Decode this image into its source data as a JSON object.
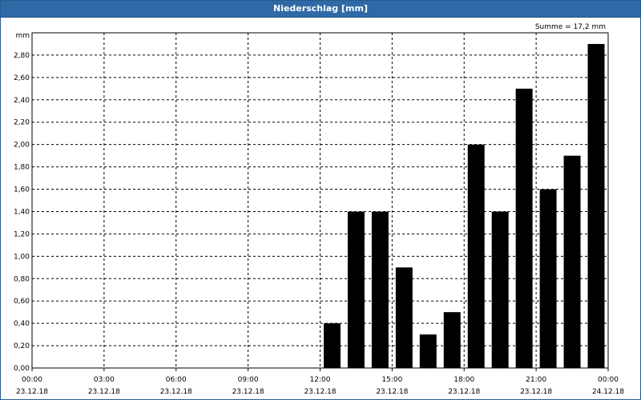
{
  "window": {
    "title": "Niederschlag [mm]"
  },
  "chart_data": {
    "type": "bar",
    "title": "Niederschlag [mm]",
    "ylabel": "mm",
    "annotation": "Summe = 17,2 mm",
    "ylim": [
      0,
      3.0
    ],
    "yticks": [
      "0,00",
      "0,20",
      "0,40",
      "0,60",
      "0,80",
      "1,00",
      "1,20",
      "1,40",
      "1,60",
      "1,80",
      "2,00",
      "2,20",
      "2,40",
      "2,60",
      "2,80"
    ],
    "xticks": [
      {
        "time": "00:00",
        "date": "23.12.18"
      },
      {
        "time": "03:00",
        "date": "23.12.18"
      },
      {
        "time": "06:00",
        "date": "23.12.18"
      },
      {
        "time": "09:00",
        "date": "23.12.18"
      },
      {
        "time": "12:00",
        "date": "23.12.18"
      },
      {
        "time": "15:00",
        "date": "23.12.18"
      },
      {
        "time": "18:00",
        "date": "23.12.18"
      },
      {
        "time": "21:00",
        "date": "23.12.18"
      },
      {
        "time": "00:00",
        "date": "24.12.18"
      }
    ],
    "grid": true,
    "bar_color": "#000000",
    "series": [
      {
        "x": [
          "00:00",
          "01:00",
          "02:00",
          "03:00",
          "04:00",
          "05:00",
          "06:00",
          "07:00",
          "08:00",
          "09:00",
          "10:00",
          "11:00",
          "12:00",
          "13:00",
          "14:00",
          "15:00",
          "16:00",
          "17:00",
          "18:00",
          "19:00",
          "20:00",
          "21:00",
          "22:00",
          "23:00"
        ],
        "values": [
          0,
          0,
          0,
          0,
          0,
          0,
          0,
          0,
          0,
          0,
          0,
          0,
          0.4,
          1.4,
          1.4,
          0.9,
          0.3,
          0.5,
          2.0,
          1.4,
          2.5,
          1.6,
          1.9,
          2.9
        ]
      }
    ]
  }
}
